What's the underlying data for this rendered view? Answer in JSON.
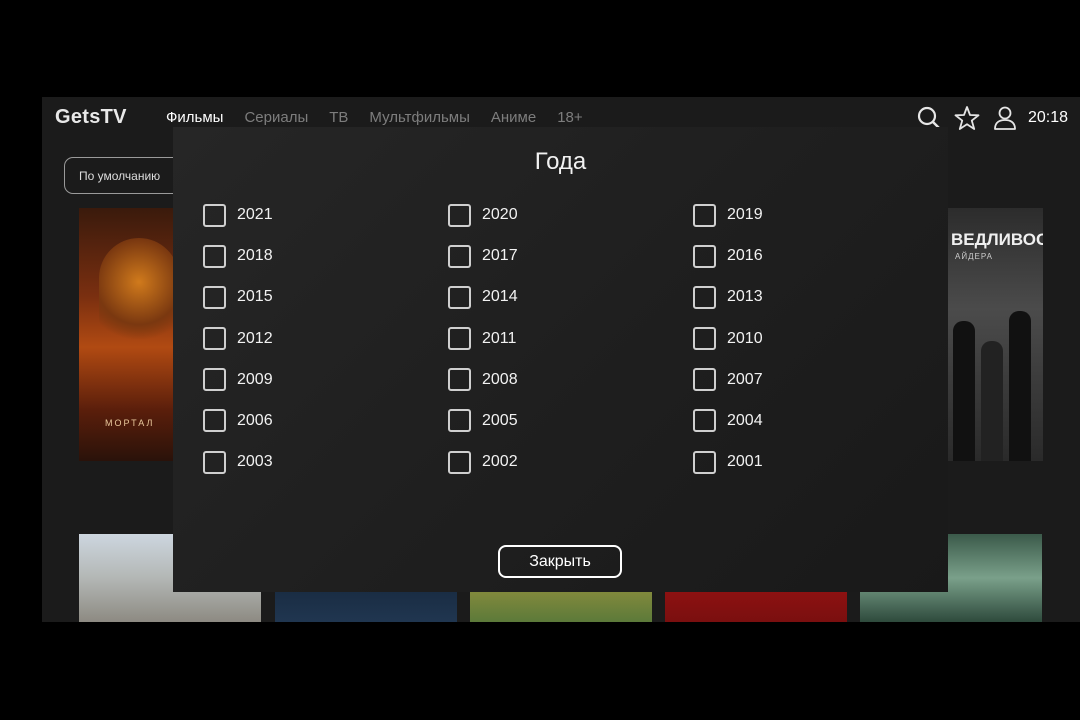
{
  "app": {
    "logo": "GetsTV",
    "clock": "20:18"
  },
  "nav": [
    {
      "label": "Фильмы",
      "active": true
    },
    {
      "label": "Сериалы",
      "active": false
    },
    {
      "label": "ТВ",
      "active": false
    },
    {
      "label": "Мультфильмы",
      "active": false
    },
    {
      "label": "Аниме",
      "active": false
    },
    {
      "label": "18+",
      "active": false
    }
  ],
  "toolbar": {
    "search_icon": "search-icon",
    "favorites_icon": "star-icon",
    "profile_icon": "user-icon"
  },
  "sort": {
    "label": "По умолчанию"
  },
  "posters": {
    "left_partial_text": "МОРТАЛ",
    "right_title": "ВЕДЛИВОСТИ",
    "right_sub": "АЙДЕРА"
  },
  "modal": {
    "title": "Года",
    "years": [
      "2021",
      "2020",
      "2019",
      "2018",
      "2017",
      "2016",
      "2015",
      "2014",
      "2013",
      "2012",
      "2011",
      "2010",
      "2009",
      "2008",
      "2007",
      "2006",
      "2005",
      "2004",
      "2003",
      "2002",
      "2001"
    ],
    "checked": [],
    "close_label": "Закрыть"
  },
  "colors": {
    "background": "#000000",
    "screen": "#1b1b1b",
    "modal": "#222222",
    "nav_inactive": "#7d7d7d",
    "text": "#ffffff"
  }
}
